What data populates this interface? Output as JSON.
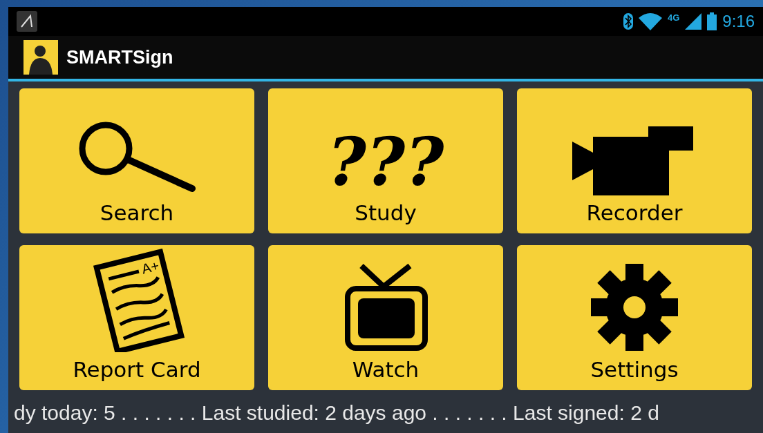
{
  "status_bar": {
    "network": "4G",
    "time": "9:16"
  },
  "action_bar": {
    "title": "SMARTSign"
  },
  "tiles": [
    {
      "kind": "search",
      "label": "Search"
    },
    {
      "kind": "study",
      "label": "Study",
      "mark": "???"
    },
    {
      "kind": "recorder",
      "label": "Recorder"
    },
    {
      "kind": "report",
      "label": "Report Card",
      "mark": "A+"
    },
    {
      "kind": "watch",
      "label": "Watch"
    },
    {
      "kind": "settings",
      "label": "Settings"
    }
  ],
  "ticker": {
    "text": "dy today: 5 . . . . . . . Last studied: 2 days ago . . . . . . . Last signed: 2 d"
  }
}
